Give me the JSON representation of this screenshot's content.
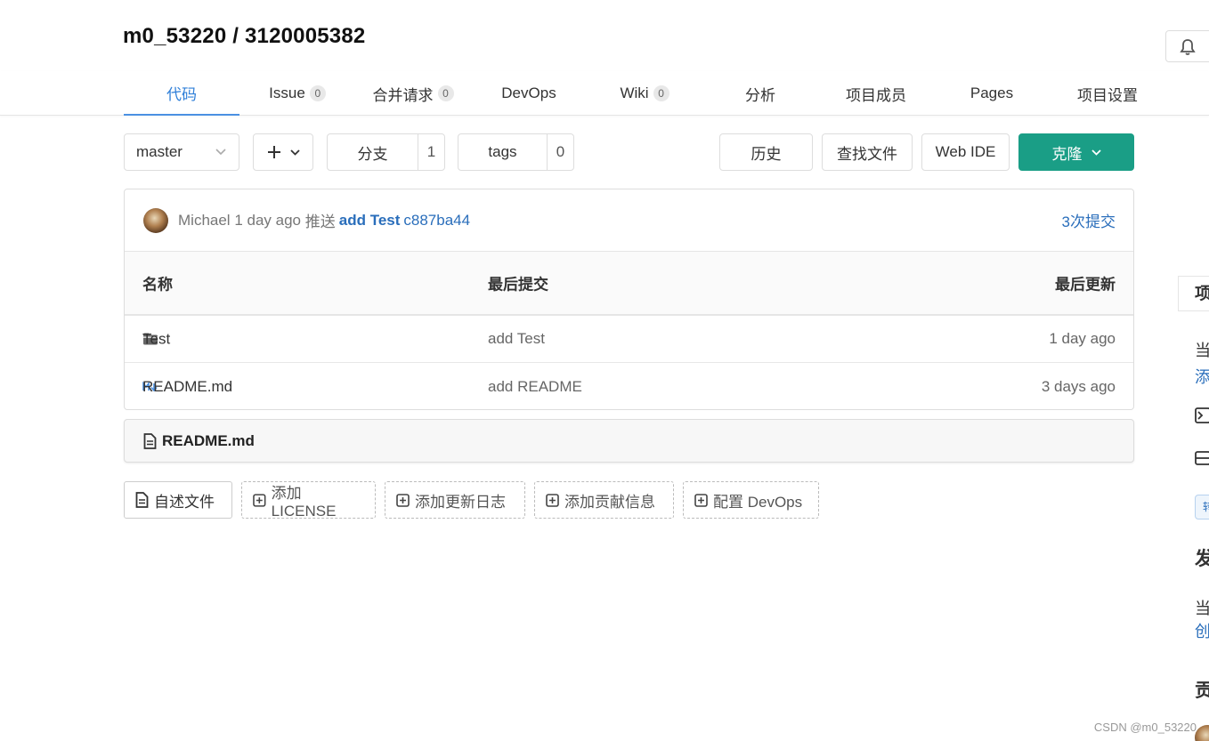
{
  "repo": {
    "title": "m0_53220 / 3120005382"
  },
  "nav": {
    "tabs": [
      {
        "label": "代码",
        "badge": null
      },
      {
        "label": "Issue",
        "badge": "0"
      },
      {
        "label": "合并请求",
        "badge": "0"
      },
      {
        "label": "DevOps",
        "badge": null
      },
      {
        "label": "Wiki",
        "badge": "0"
      },
      {
        "label": "分析",
        "badge": null
      },
      {
        "label": "项目成员",
        "badge": null
      },
      {
        "label": "Pages",
        "badge": null
      },
      {
        "label": "项目设置",
        "badge": null
      }
    ],
    "active_tab": "代码"
  },
  "toolbar": {
    "branch": "master",
    "branches_label": "分支",
    "branches_count": "1",
    "tags_label": "tags",
    "tags_count": "0",
    "history_label": "历史",
    "find_file_label": "查找文件",
    "web_ide_label": "Web IDE",
    "clone_label": "克隆",
    "clone_color": "#1a9e86"
  },
  "last_commit": {
    "author": "Michael",
    "time": "1 day ago",
    "action": "推送",
    "message": "add Test",
    "sha": "c887ba44",
    "commit_count": "3次提交"
  },
  "file_table": {
    "headers": {
      "name": "名称",
      "last_commit": "最后提交",
      "last_update": "最后更新"
    },
    "rows": [
      {
        "icon": "folder-icon",
        "name": "Test",
        "commit": "add Test",
        "updated": "1 day ago"
      },
      {
        "icon": "markdown-icon",
        "name": "README.md",
        "commit": "add README",
        "updated": "3 days ago"
      }
    ]
  },
  "readme": {
    "title": "README.md"
  },
  "actions": [
    {
      "label": "自述文件",
      "icon": "file-icon"
    },
    {
      "label": "添加LICENSE",
      "icon": "plus-square-icon"
    },
    {
      "label": "添加更新日志",
      "icon": "plus-square-icon"
    },
    {
      "label": "添加贡献信息",
      "icon": "plus-square-icon"
    },
    {
      "label": "配置 DevOps",
      "icon": "plus-square-icon"
    }
  ],
  "sidebar": {
    "title": "项",
    "line1": "当",
    "link1": "添",
    "heading2": "发",
    "line2": "当",
    "link2": "创",
    "heading3": "贡"
  },
  "watermark": "CSDN @m0_53220"
}
